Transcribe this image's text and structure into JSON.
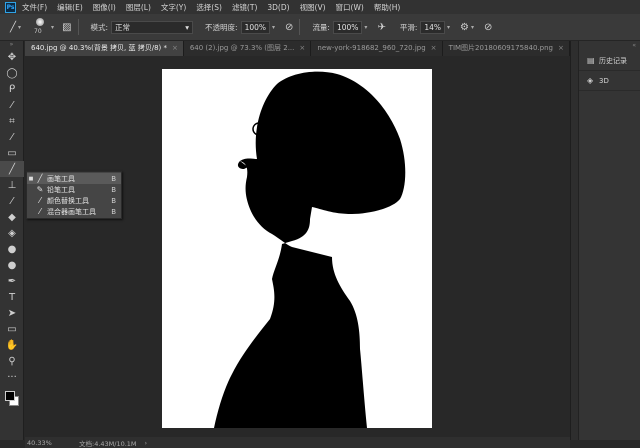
{
  "app": {
    "logo_text": "Ps"
  },
  "menubar": {
    "items": [
      "文件(F)",
      "编辑(E)",
      "图像(I)",
      "图层(L)",
      "文字(Y)",
      "选择(S)",
      "滤镜(T)",
      "3D(D)",
      "视图(V)",
      "窗口(W)",
      "帮助(H)"
    ]
  },
  "options": {
    "brush_size": "70",
    "mode_label": "模式:",
    "mode_value": "正常",
    "opacity_label": "不透明度:",
    "opacity_value": "100%",
    "flow_label": "流量:",
    "flow_value": "100%",
    "smoothing_label": "平滑:",
    "smoothing_value": "14%"
  },
  "tabs": [
    {
      "label": "640.jpg @ 40.3%(背景 拷贝, 蓝 拷贝/8) *",
      "close": "×"
    },
    {
      "label": "640 (2).jpg @ 73.3% (图层 2...",
      "close": "×"
    },
    {
      "label": "new-york-918682_960_720.jpg",
      "close": "×"
    },
    {
      "label": "TIM图片20180609175840.png",
      "close": "×"
    }
  ],
  "flyout": {
    "items": [
      {
        "label": "画笔工具",
        "key": "B",
        "icon": "brush-icon",
        "glyph": "╱",
        "selected": true
      },
      {
        "label": "铅笔工具",
        "key": "B",
        "icon": "pencil-icon",
        "glyph": "✎",
        "selected": false
      },
      {
        "label": "颜色替换工具",
        "key": "B",
        "icon": "color-replace-icon",
        "glyph": "⁄",
        "selected": false
      },
      {
        "label": "混合器画笔工具",
        "key": "B",
        "icon": "mixer-brush-icon",
        "glyph": "⁄",
        "selected": false
      }
    ]
  },
  "right_panel": {
    "items": [
      {
        "label": "历史记录",
        "icon": "history-icon",
        "glyph": "▤"
      },
      {
        "label": "3D",
        "icon": "3d-icon",
        "glyph": "◈"
      }
    ]
  },
  "status": {
    "zoom": "40.33%",
    "doc_size": "文档:4.43M/10.1M",
    "arrow": "›"
  },
  "colors": {
    "foreground": "#000000",
    "background": "#ffffff"
  }
}
